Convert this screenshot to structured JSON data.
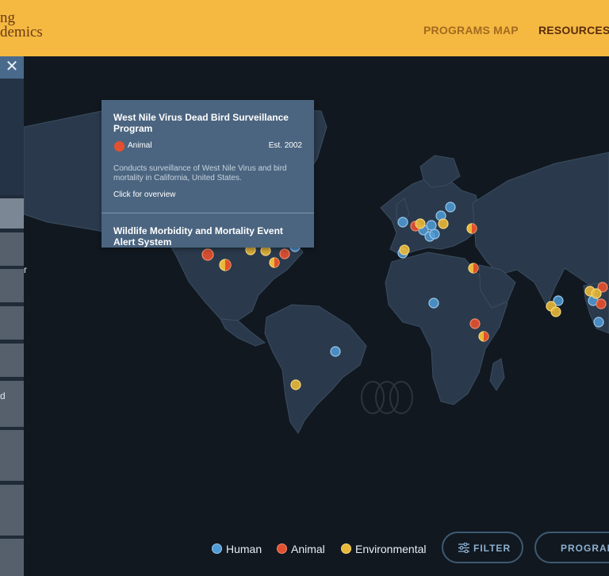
{
  "header": {
    "logo_lines": [
      "ng",
      "demics"
    ],
    "nav": {
      "programs_map": "PROGRAMS MAP",
      "resources": "RESOURCES"
    }
  },
  "sidebar": {
    "close_symbol": "✕",
    "fragments": [
      "r",
      "d"
    ]
  },
  "popup": {
    "title": "West Nile Virus Dead Bird Surveillance Program",
    "category": "Animal",
    "established": "Est. 2002",
    "description": "Conducts surveillance of West Nile Virus and bird mortality in California, United States.",
    "link": "Click for overview",
    "next_title": "Wildlife Morbidity and Mortality Event Alert System"
  },
  "legend": {
    "human": "Human",
    "animal": "Animal",
    "environmental": "Environmental"
  },
  "buttons": {
    "filter": "FILTER",
    "programs": "PROGRAMS"
  },
  "colors": {
    "header_bg": "#f5b942",
    "ocean": "#111820",
    "land": "#2a3a4c",
    "human": "#4f9bd6",
    "animal": "#e4502f",
    "environmental": "#e8b838",
    "popup_bg": "#4b6580"
  }
}
